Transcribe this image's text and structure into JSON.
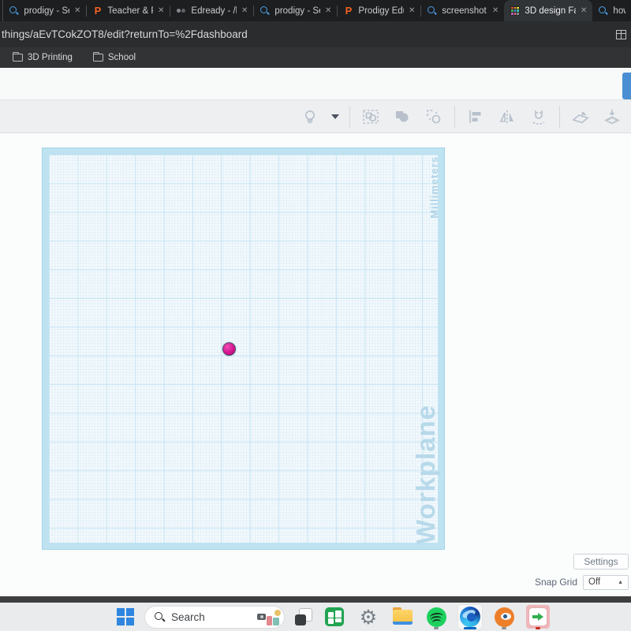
{
  "glyphs": {
    "close": "✕",
    "caret_up": "▲",
    "prodigy": "P",
    "gear": "⚙"
  },
  "browser": {
    "tabs": [
      {
        "title": "prodigy - Se",
        "icon": "search"
      },
      {
        "title": "Teacher & Pa",
        "icon": "prodigy"
      },
      {
        "title": "Edready - /lo",
        "icon": "edready"
      },
      {
        "title": "prodigy - Se",
        "icon": "search"
      },
      {
        "title": "Prodigy Edu",
        "icon": "prodigy"
      },
      {
        "title": "screenshot o",
        "icon": "search"
      },
      {
        "title": "3D design Fa",
        "icon": "tinkercad",
        "active": true
      },
      {
        "title": "how l",
        "icon": "search"
      }
    ],
    "url": "things/aEvTCokZOT8/edit?returnTo=%2Fdashboard",
    "bookmarks": [
      {
        "label": "3D Printing"
      },
      {
        "label": "School"
      }
    ]
  },
  "page": {
    "workplane": {
      "units_label": "Millimeters",
      "name_label": "Workplane"
    },
    "object": {
      "type": "sphere",
      "color": "#d6148f"
    },
    "toolbar_icons": [
      "show-all-lightbulb",
      "show-all-caret",
      "select-group",
      "group",
      "ungroup",
      "align",
      "mirror",
      "snap-magnet",
      "workplane-tool",
      "ruler-tool"
    ],
    "panel": {
      "settings": "Settings",
      "snap_grid_label": "Snap Grid",
      "snap_grid_value": "Off"
    }
  },
  "taskbar": {
    "search_placeholder": "Search"
  },
  "colors": {
    "accent_blue": "#0067c0",
    "workplane_blue": "#bfe2f1",
    "sphere_magenta": "#d6148f",
    "attention_pink": "#efb6ba",
    "chrome_dark": "#1c1e20"
  }
}
